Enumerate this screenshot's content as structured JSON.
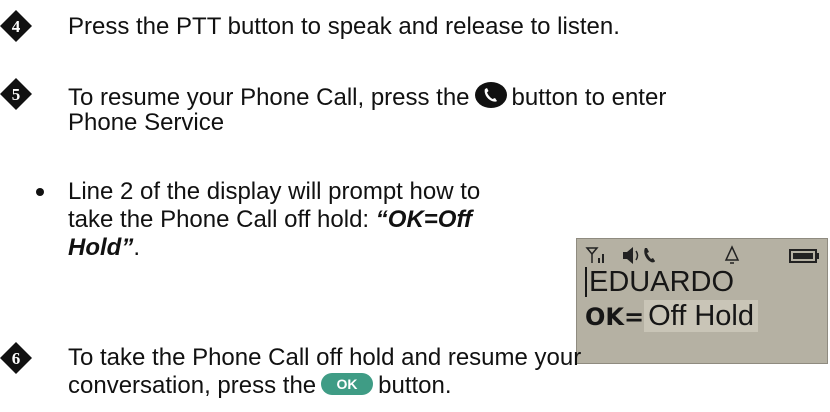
{
  "steps": [
    {
      "number": "4",
      "text": "Press the PTT button to speak and release to listen."
    },
    {
      "number": "5",
      "text_before": "To resume your Phone Call, press the",
      "text_after": "button to enter",
      "line2": "Phone Service"
    },
    {
      "number": "6",
      "line1": "To take the Phone Call off hold and resume your",
      "line2_before": "conversation, press the",
      "line2_after": "button."
    }
  ],
  "bullet": {
    "line1": "Line 2 of the display will prompt how to",
    "line2_before": "take the Phone Call off hold: ",
    "line2_emph": "“OK=Off",
    "line3_emph": "Hold”",
    "line3_after": "."
  },
  "lcd": {
    "line1": "EDUARDO",
    "line2_prefix": "OK=",
    "line2_value": "Off Hold"
  },
  "ok_button_label": "OK",
  "colors": {
    "badge": "#111111",
    "phone_button": "#111111",
    "ok_button": "#3f9c85",
    "lcd_bg": "#b5b1a3"
  }
}
